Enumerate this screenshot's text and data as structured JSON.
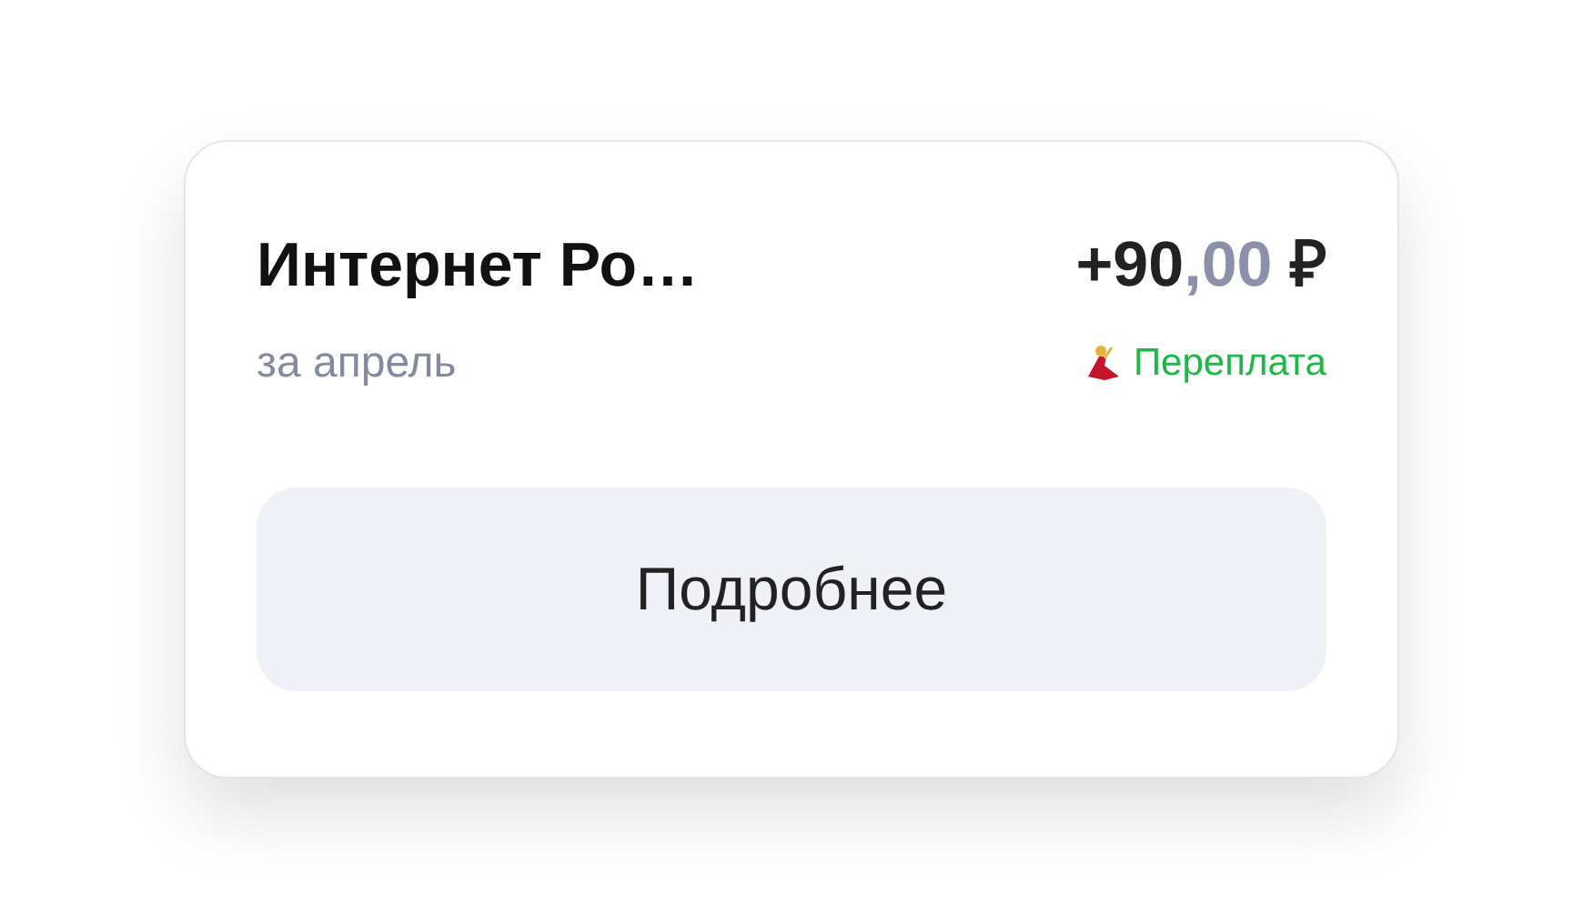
{
  "card": {
    "title": "Интернет Ро…",
    "subtitle": "за апрель",
    "amount": {
      "integer": "+90",
      "fraction": ",00",
      "currency": "₽"
    },
    "status": {
      "label": "Переплата"
    },
    "button": "Подробнее"
  }
}
